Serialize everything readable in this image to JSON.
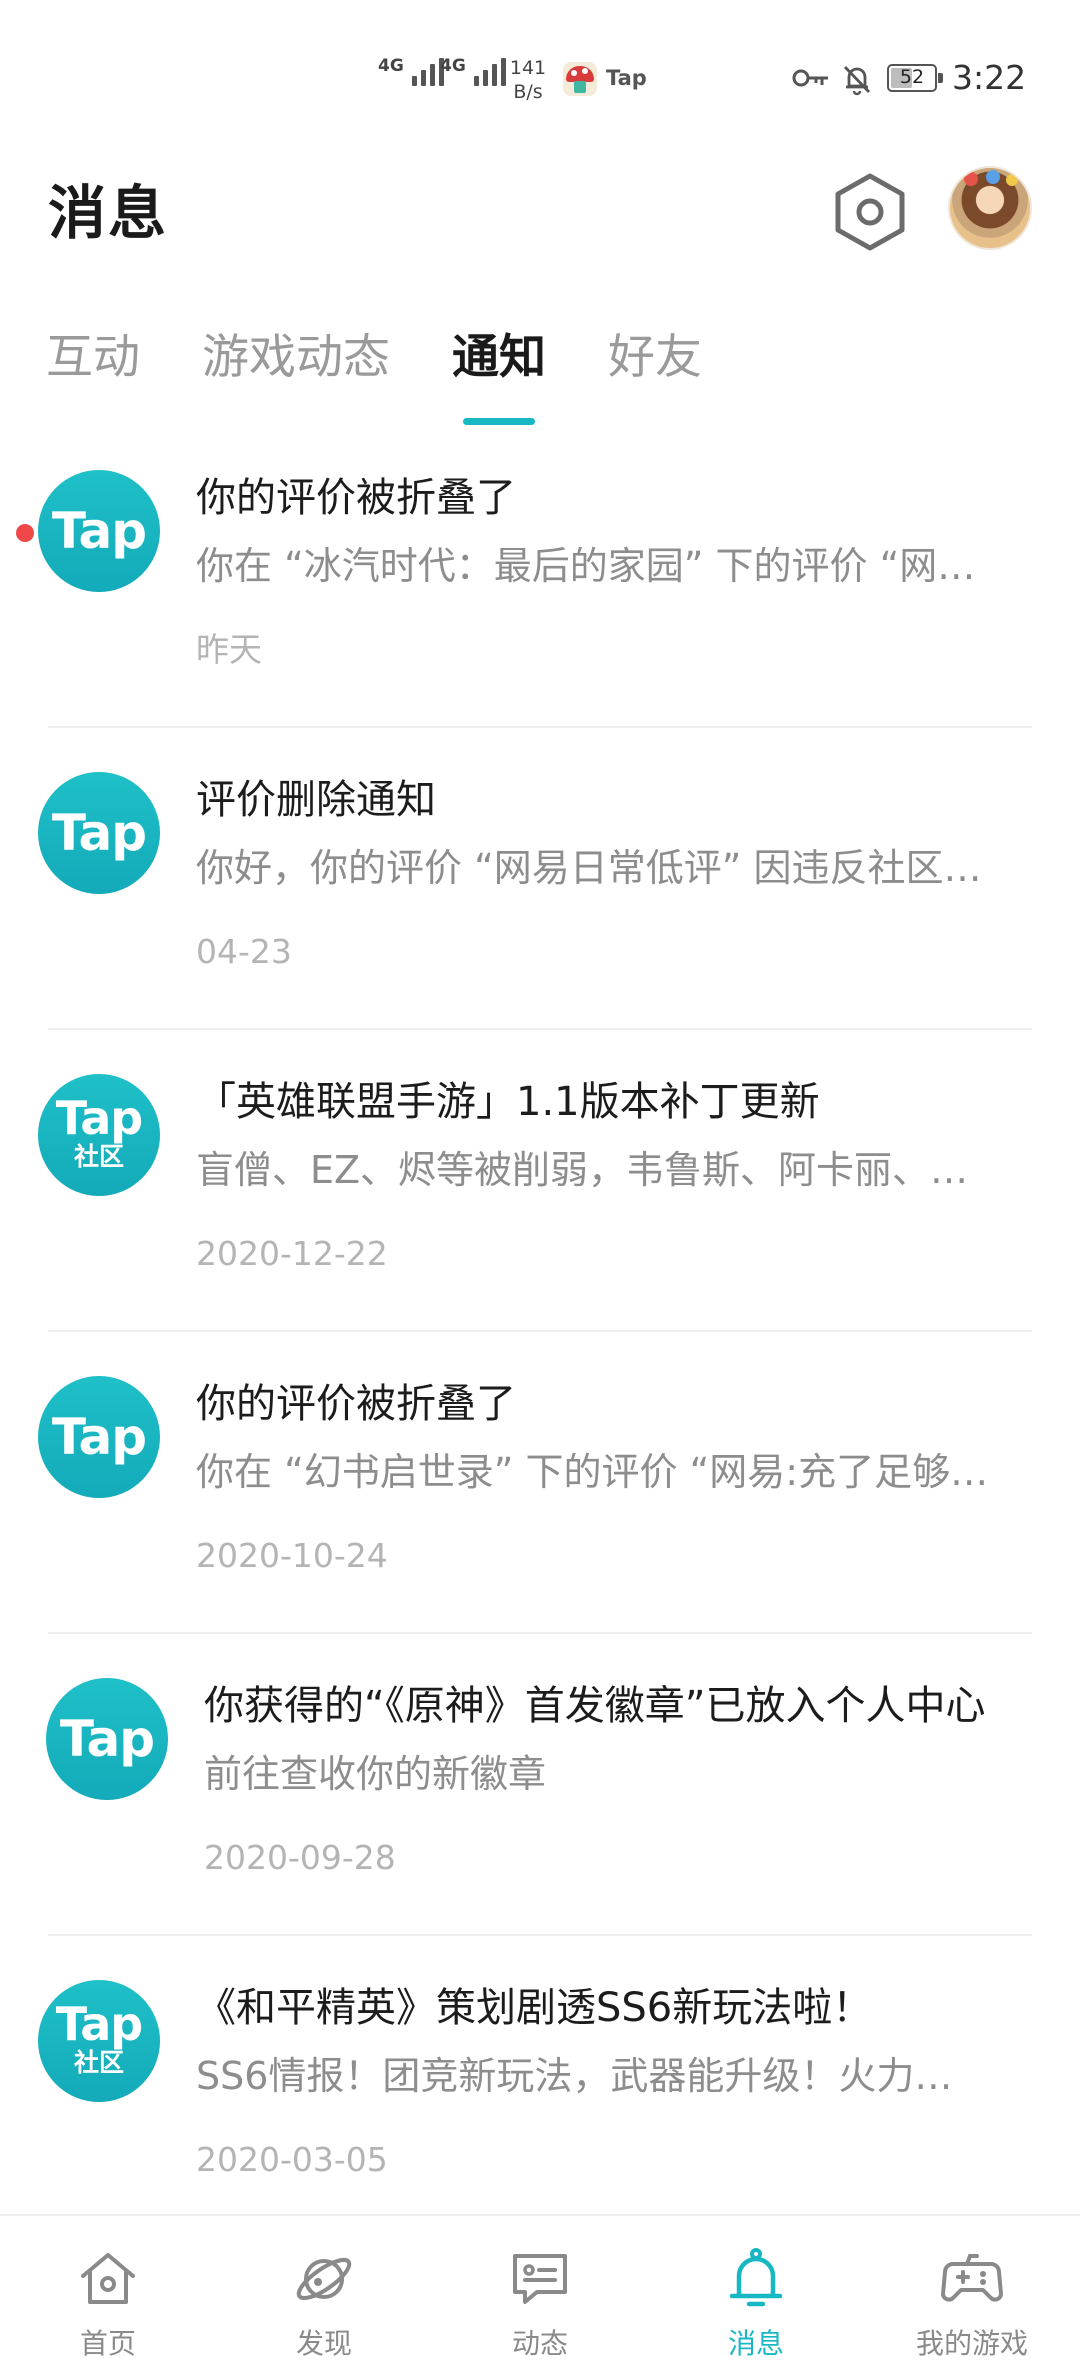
{
  "status_bar": {
    "network_1": "4G",
    "network_2": "4G",
    "speed_value": "141",
    "speed_unit": "B/s",
    "app_label": "Tap",
    "battery_level": "52",
    "time": "3:22"
  },
  "header": {
    "title": "消息",
    "settings_icon": "settings-hexagon-icon",
    "avatar": "user-avatar"
  },
  "tabs": [
    {
      "label": "互动",
      "active": false
    },
    {
      "label": "游戏动态",
      "active": false
    },
    {
      "label": "通知",
      "active": true
    },
    {
      "label": "好友",
      "active": false
    }
  ],
  "notifications": [
    {
      "logo_text": "Tap",
      "logo_sub": "",
      "unread": true,
      "title": "你的评价被折叠了",
      "desc": "你在 “冰汽时代：最后的家园” 下的评价 “网…",
      "date": "昨天"
    },
    {
      "logo_text": "Tap",
      "logo_sub": "",
      "unread": false,
      "title": "评价删除通知",
      "desc": "你好，你的评价 “网易日常低评” 因违反社区…",
      "date": "04-23"
    },
    {
      "logo_text": "Tap",
      "logo_sub": "社区",
      "unread": false,
      "title": "「英雄联盟手游」1.1版本补丁更新",
      "desc": "盲僧、EZ、烬等被削弱，韦鲁斯、阿卡丽、…",
      "date": "2020-12-22"
    },
    {
      "logo_text": "Tap",
      "logo_sub": "",
      "unread": false,
      "title": "你的评价被折叠了",
      "desc": "你在 “幻书启世录” 下的评价 “网易:充了足够…",
      "date": "2020-10-24"
    },
    {
      "logo_text": "Tap",
      "logo_sub": "",
      "unread": false,
      "title": "你获得的“《原神》首发徽章”已放入个人中心",
      "desc": "前往查收你的新徽章",
      "date": "2020-09-28"
    },
    {
      "logo_text": "Tap",
      "logo_sub": "社区",
      "unread": false,
      "title": "《和平精英》策划剧透SS6新玩法啦！",
      "desc": "SS6情报！团竞新玩法，武器能升级！火力…",
      "date": "2020-03-05"
    }
  ],
  "bottom_nav": [
    {
      "label": "首页",
      "icon": "home-icon",
      "active": false
    },
    {
      "label": "发现",
      "icon": "planet-icon",
      "active": false
    },
    {
      "label": "动态",
      "icon": "chat-card-icon",
      "active": false
    },
    {
      "label": "消息",
      "icon": "bell-icon",
      "active": true
    },
    {
      "label": "我的游戏",
      "icon": "gamepad-icon",
      "active": false
    }
  ],
  "colors": {
    "accent": "#17b8c4",
    "unread": "#f0474a",
    "title_text": "#1c1c1c",
    "secondary_text": "#8d8d8d",
    "date_text": "#b4b4b4"
  }
}
